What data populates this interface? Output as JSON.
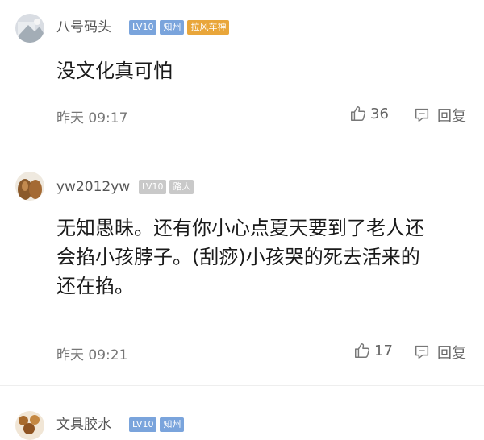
{
  "comments": [
    {
      "username": "八号码头",
      "badges": [
        "LV10",
        "知州",
        "拉风车神"
      ],
      "text": "没文化真可怕",
      "time": "昨天 09:17",
      "likes": "36",
      "reply_label": "回复"
    },
    {
      "username": "yw2012yw",
      "badges": [
        "LV10",
        "路人"
      ],
      "text_lines": [
        "无知愚昧。还有你小心点夏天要到了老人还",
        "会掐小孩脖子。(刮痧)小孩哭的死去活来的",
        "还在掐。"
      ],
      "time": "昨天 09:21",
      "likes": "17",
      "reply_label": "回复"
    },
    {
      "username": "文具胶水",
      "badges": [
        "LV10",
        "知州"
      ]
    }
  ],
  "colors": {
    "badge_blue": "#7aa4dc",
    "badge_orange": "#e9a63a",
    "badge_grey": "#c9c9c9"
  }
}
